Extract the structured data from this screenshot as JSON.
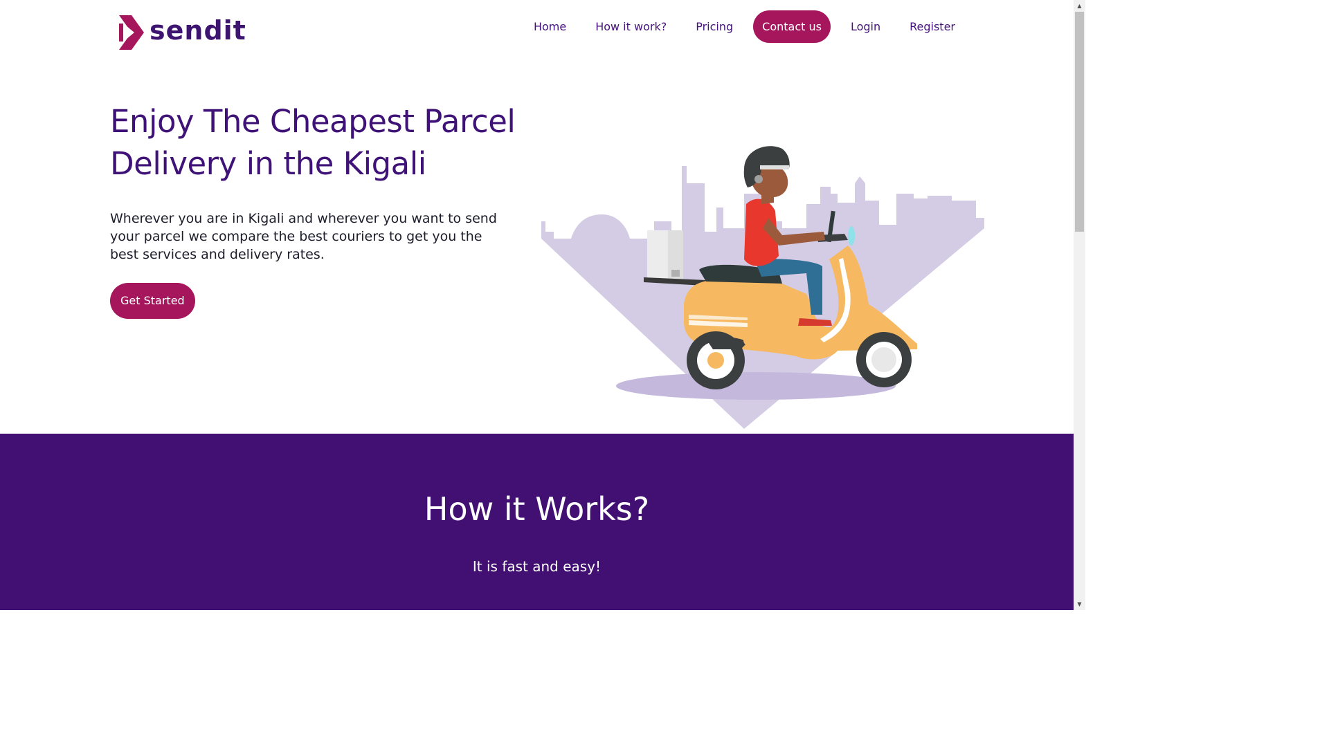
{
  "brand": {
    "logo_text": "sendit",
    "logo_icon": "arrow-chevron-logo-icon",
    "primary_color": "#a6165d",
    "secondary_color": "#421073"
  },
  "nav": {
    "items": [
      {
        "label": "Home"
      },
      {
        "label": "How it work?"
      },
      {
        "label": "Pricing"
      },
      {
        "label": "Contact us",
        "active": true
      },
      {
        "label": "Login"
      },
      {
        "label": "Register"
      }
    ]
  },
  "hero": {
    "title": "Enjoy The Cheapest Parcel Delivery in the Kigali",
    "text": "Wherever you are in Kigali and wherever you want to send your parcel we compare the best couriers to get you the best services and delivery rates.",
    "cta_label": "Get Started",
    "illustration_icon": "delivery-scooter-illustration"
  },
  "how_it_works": {
    "title": "How it Works?",
    "subtitle": "It is fast and easy!"
  }
}
